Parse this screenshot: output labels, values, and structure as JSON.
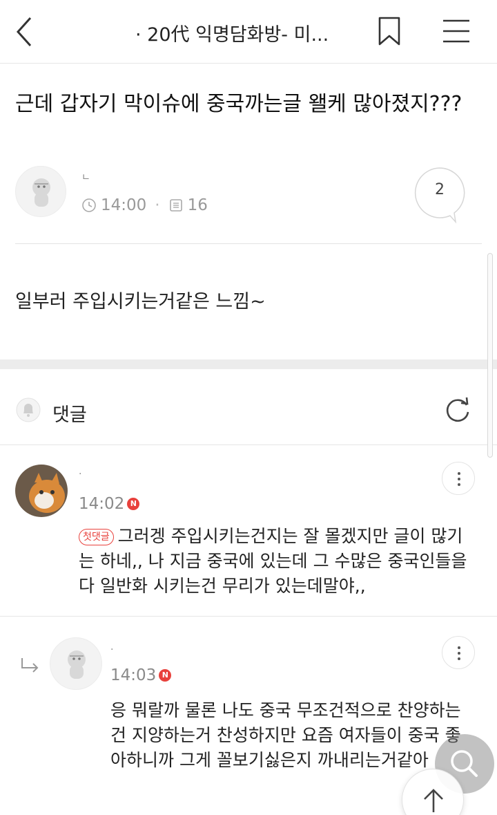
{
  "header": {
    "title": "· 20代 익명담화방- 미...",
    "back_icon": "chevron-left-icon",
    "bookmark_icon": "bookmark-icon",
    "menu_icon": "hamburger-menu-icon"
  },
  "post": {
    "title": "근데 갑자기 막이슈에 중국까는글 왤케 많아졌지???",
    "author_name": "ㄴ",
    "time": "14:00",
    "views": "16",
    "comment_count": "2",
    "body": "일부러 주입시키는거같은 느낌~"
  },
  "comments_section": {
    "label": "댓글"
  },
  "comments": [
    {
      "name": "·",
      "time": "14:02",
      "badge": "N",
      "tag": "첫댓글",
      "text": "그러겡 주입시키는건지는 잘 몰겠지만 글이 많기는 하네,, 나 지금 중국에 있는데 그 수많은 중국인들을 다 일반화 시키는건 무리가 있는데말야,,"
    },
    {
      "name": "·",
      "time": "14:03",
      "badge": "N",
      "text": "응 뭐랄까 물론 나도 중국 무조건적으로 찬양하는건 지양하는거 찬성하지만 요즘 여자들이 중국 좋아하니까 그게 꼴보기싫은지 까내리는거같아"
    }
  ],
  "colors": {
    "accent_red": "#e8413c",
    "divider": "#e6e6e6",
    "muted_text": "#8a8a8a"
  }
}
